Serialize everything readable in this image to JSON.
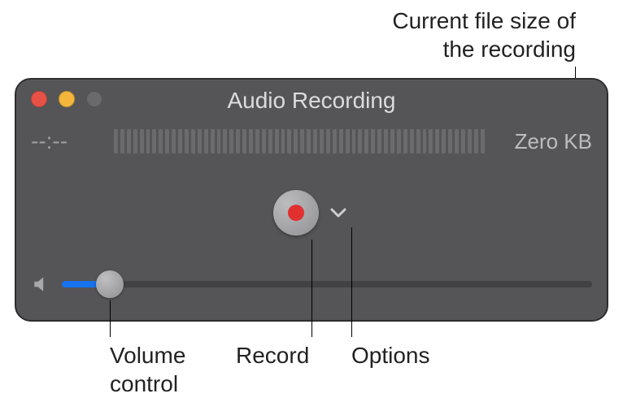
{
  "callouts": {
    "filesize": "Current file size of\nthe recording",
    "volume": "Volume\ncontrol",
    "record": "Record",
    "options": "Options"
  },
  "window": {
    "title": "Audio Recording",
    "time": "--:--",
    "filesize": "Zero KB"
  }
}
